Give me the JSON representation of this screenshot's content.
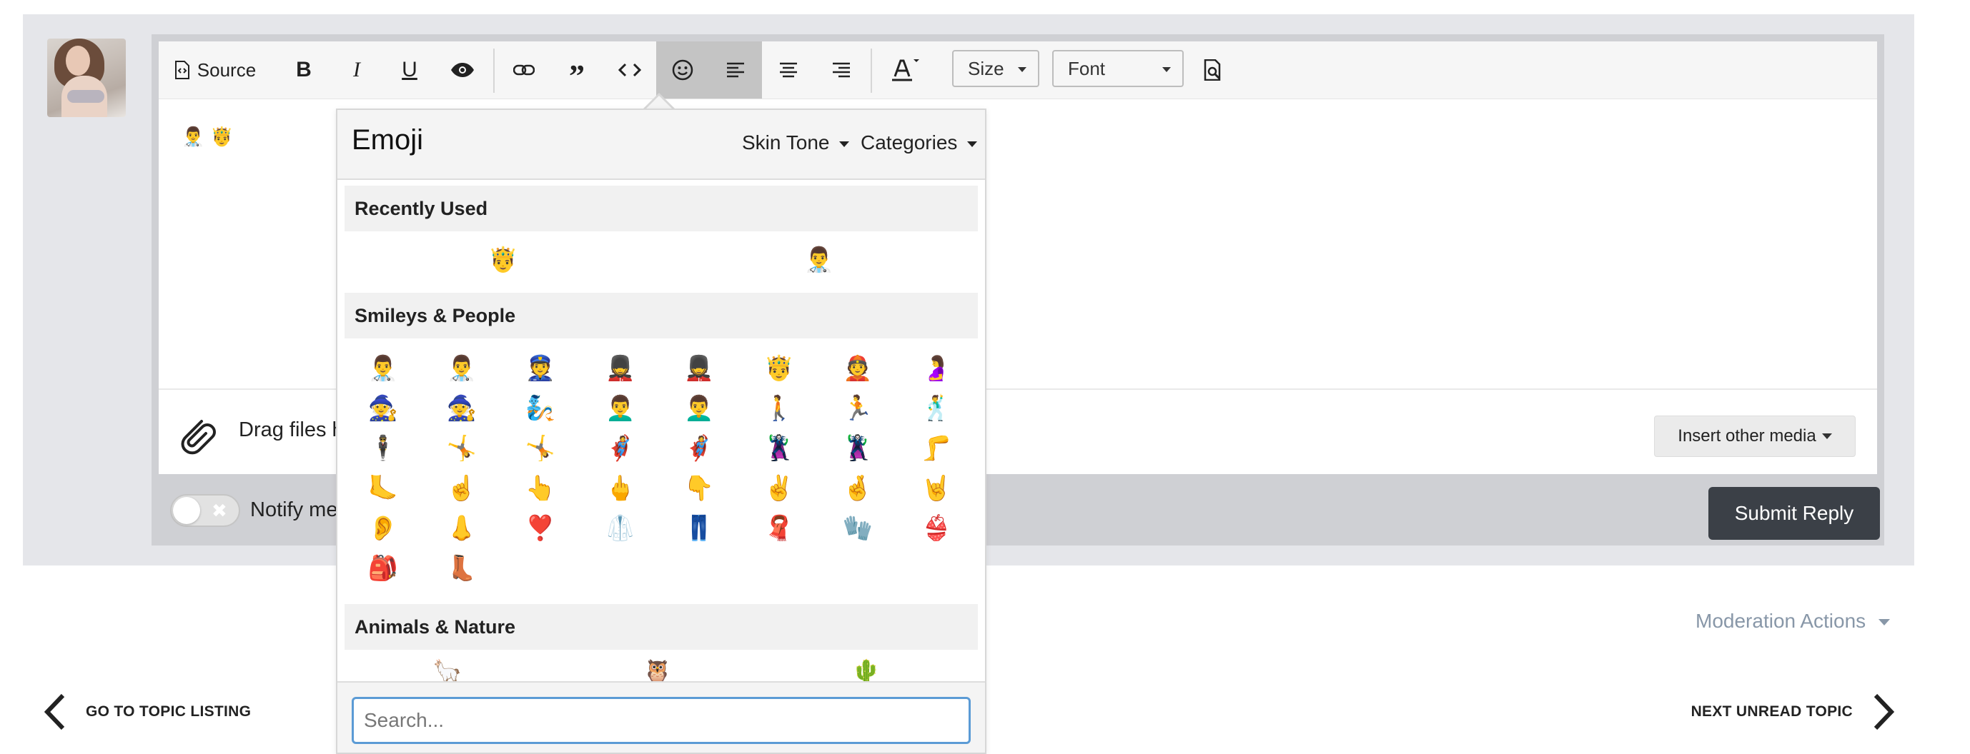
{
  "toolbar": {
    "source_label": "Source",
    "size_label": "Size",
    "font_label": "Font"
  },
  "editor": {
    "content_emoji": [
      "👨‍⚕️",
      "🤴"
    ]
  },
  "attach": {
    "drag_text": "Drag files h",
    "insert_media_label": "Insert other media"
  },
  "notify_text": "Notify me",
  "submit_label": "Submit Reply",
  "moderation_label": "Moderation Actions",
  "nav": {
    "prev_label": "GO TO TOPIC LISTING",
    "next_label": "NEXT UNREAD TOPIC"
  },
  "emoji_picker": {
    "title": "Emoji",
    "skin_tone_label": "Skin Tone",
    "categories_label": "Categories",
    "search_placeholder": "Search...",
    "sections": {
      "recent": {
        "label": "Recently Used",
        "emoji": [
          "🤴",
          "👨‍⚕️"
        ]
      },
      "smileys": {
        "label": "Smileys & People",
        "emoji": [
          "👨‍⚕️",
          "👨‍⚕️",
          "👮",
          "💂",
          "💂",
          "🤴",
          "👲",
          "🤰",
          "🧙",
          "🧙",
          "🧞",
          "👨‍🦱",
          "👨‍🦱",
          "🚶",
          "🏃",
          "🕺",
          "🕴️",
          "🤸",
          "🤸",
          "🦸",
          "🦸",
          "🦹",
          "🦹",
          "🦵",
          "🦶",
          "☝️",
          "👆",
          "🖕",
          "👇",
          "✌️",
          "🤞",
          "🤘",
          "👂",
          "👃",
          "❣️",
          "🥼",
          "👖",
          "🧣",
          "🧤",
          "👙",
          "🎒",
          "👢"
        ]
      },
      "animals": {
        "label": "Animals & Nature",
        "emoji": [
          "🦙",
          "🦉",
          "🌵"
        ]
      }
    }
  }
}
